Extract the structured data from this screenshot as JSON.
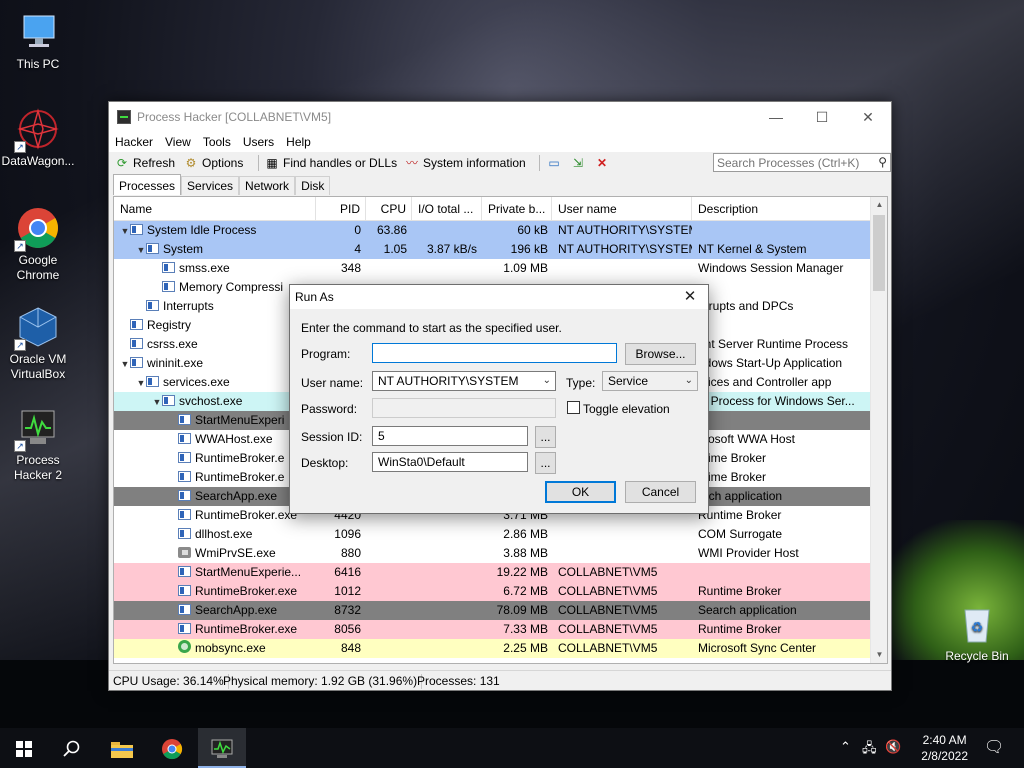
{
  "desktop": {
    "icons": [
      {
        "label": "This PC"
      },
      {
        "label": "DataWagon..."
      },
      {
        "label": "Google Chrome"
      },
      {
        "label": "Oracle VM VirtualBox"
      },
      {
        "label": "Process Hacker 2"
      },
      {
        "label": "Recycle Bin"
      }
    ]
  },
  "window": {
    "title": "Process Hacker [COLLABNET\\VM5]",
    "controls": {
      "minimize": "—",
      "maximize": "☐",
      "close": "✕"
    },
    "menu": [
      "Hacker",
      "View",
      "Tools",
      "Users",
      "Help"
    ],
    "toolbar": {
      "refresh": "Refresh",
      "options": "Options",
      "find_handles": "Find handles or DLLs",
      "system_info": "System information"
    },
    "search": {
      "placeholder": "Search Processes (Ctrl+K)"
    },
    "tabs": [
      "Processes",
      "Services",
      "Network",
      "Disk"
    ],
    "columns": [
      "Name",
      "PID",
      "CPU",
      "I/O total ...",
      "Private b...",
      "User name",
      "Description"
    ],
    "rows": [
      {
        "name": "System Idle Process",
        "pid": "0",
        "cpu": "63.86",
        "io": "",
        "priv": "60 kB",
        "user": "NT AUTHORITY\\SYSTEM",
        "desc": "",
        "indent": 0,
        "toggle": "▼",
        "bg": "#a9c6f5"
      },
      {
        "name": "System",
        "pid": "4",
        "cpu": "1.05",
        "io": "3.87 kB/s",
        "priv": "196 kB",
        "user": "NT AUTHORITY\\SYSTEM",
        "desc": "NT Kernel & System",
        "indent": 1,
        "toggle": "▼",
        "bg": "#a9c6f5"
      },
      {
        "name": "smss.exe",
        "pid": "348",
        "cpu": "",
        "io": "",
        "priv": "1.09 MB",
        "user": "",
        "desc": "Windows Session Manager",
        "indent": 2,
        "toggle": "",
        "bg": "#ffffff"
      },
      {
        "name": "Memory Compressi",
        "pid": "",
        "cpu": "",
        "io": "",
        "priv": "",
        "user": "",
        "desc": "",
        "indent": 2,
        "toggle": "",
        "bg": "#ffffff"
      },
      {
        "name": "Interrupts",
        "pid": "",
        "cpu": "",
        "io": "",
        "priv": "",
        "user": "",
        "desc": "errupts and DPCs",
        "indent": 1,
        "toggle": "",
        "bg": "#ffffff"
      },
      {
        "name": "Registry",
        "pid": "",
        "cpu": "",
        "io": "",
        "priv": "",
        "user": "",
        "desc": "",
        "indent": 0,
        "toggle": "",
        "bg": "#ffffff"
      },
      {
        "name": "csrss.exe",
        "pid": "",
        "cpu": "",
        "io": "",
        "priv": "",
        "user": "",
        "desc": "ent Server Runtime Process",
        "indent": 0,
        "toggle": "",
        "bg": "#ffffff"
      },
      {
        "name": "wininit.exe",
        "pid": "",
        "cpu": "",
        "io": "",
        "priv": "",
        "user": "",
        "desc": "ndows Start-Up Application",
        "indent": 0,
        "toggle": "▼",
        "bg": "#ffffff"
      },
      {
        "name": "services.exe",
        "pid": "",
        "cpu": "",
        "io": "",
        "priv": "",
        "user": "",
        "desc": "rvices and Controller app",
        "indent": 1,
        "toggle": "▼",
        "bg": "#ffffff"
      },
      {
        "name": "svchost.exe",
        "pid": "",
        "cpu": "",
        "io": "",
        "priv": "",
        "user": "",
        "desc": "st Process for Windows Ser...",
        "indent": 2,
        "toggle": "▼",
        "bg": "#cdf5f5"
      },
      {
        "name": "StartMenuExperi",
        "pid": "",
        "cpu": "",
        "io": "",
        "priv": "",
        "user": "",
        "desc": "",
        "indent": 3,
        "toggle": "",
        "bg": "#808080"
      },
      {
        "name": "WWAHost.exe",
        "pid": "",
        "cpu": "",
        "io": "",
        "priv": "",
        "user": "",
        "desc": "crosoft WWA Host",
        "indent": 3,
        "toggle": "",
        "bg": "#ffffff"
      },
      {
        "name": "RuntimeBroker.e",
        "pid": "",
        "cpu": "",
        "io": "",
        "priv": "",
        "user": "",
        "desc": "ntime Broker",
        "indent": 3,
        "toggle": "",
        "bg": "#ffffff"
      },
      {
        "name": "RuntimeBroker.e",
        "pid": "",
        "cpu": "",
        "io": "",
        "priv": "",
        "user": "",
        "desc": "ntime Broker",
        "indent": 3,
        "toggle": "",
        "bg": "#ffffff"
      },
      {
        "name": "SearchApp.exe",
        "pid": "",
        "cpu": "",
        "io": "",
        "priv": "",
        "user": "",
        "desc": "arch application",
        "indent": 3,
        "toggle": "",
        "bg": "#808080"
      },
      {
        "name": "RuntimeBroker.exe",
        "pid": "4420",
        "cpu": "",
        "io": "",
        "priv": "3.71 MB",
        "user": "",
        "desc": "Runtime Broker",
        "indent": 3,
        "toggle": "",
        "bg": "#ffffff"
      },
      {
        "name": "dllhost.exe",
        "pid": "1096",
        "cpu": "",
        "io": "",
        "priv": "2.86 MB",
        "user": "",
        "desc": "COM Surrogate",
        "indent": 3,
        "toggle": "",
        "bg": "#ffffff",
        "icon": "blank"
      },
      {
        "name": "WmiPrvSE.exe",
        "pid": "880",
        "cpu": "",
        "io": "",
        "priv": "3.88 MB",
        "user": "",
        "desc": "WMI Provider Host",
        "indent": 3,
        "toggle": "",
        "bg": "#ffffff",
        "icon": "gear"
      },
      {
        "name": "StartMenuExperie...",
        "pid": "6416",
        "cpu": "",
        "io": "",
        "priv": "19.22 MB",
        "user": "COLLABNET\\VM5",
        "desc": "",
        "indent": 3,
        "toggle": "",
        "bg": "#ffc8d2"
      },
      {
        "name": "RuntimeBroker.exe",
        "pid": "1012",
        "cpu": "",
        "io": "",
        "priv": "6.72 MB",
        "user": "COLLABNET\\VM5",
        "desc": "Runtime Broker",
        "indent": 3,
        "toggle": "",
        "bg": "#ffc8d2"
      },
      {
        "name": "SearchApp.exe",
        "pid": "8732",
        "cpu": "",
        "io": "",
        "priv": "78.09 MB",
        "user": "COLLABNET\\VM5",
        "desc": "Search application",
        "indent": 3,
        "toggle": "",
        "bg": "#808080"
      },
      {
        "name": "RuntimeBroker.exe",
        "pid": "8056",
        "cpu": "",
        "io": "",
        "priv": "7.33 MB",
        "user": "COLLABNET\\VM5",
        "desc": "Runtime Broker",
        "indent": 3,
        "toggle": "",
        "bg": "#ffc8d2"
      },
      {
        "name": "mobsync.exe",
        "pid": "848",
        "cpu": "",
        "io": "",
        "priv": "2.25 MB",
        "user": "COLLABNET\\VM5",
        "desc": "Microsoft Sync Center",
        "indent": 3,
        "toggle": "",
        "bg": "#ffffc0",
        "icon": "sync"
      }
    ],
    "status": {
      "cpu": "CPU Usage: 36.14%",
      "memory": "Physical memory: 1.92 GB (31.96%)",
      "processes": "Processes: 131"
    }
  },
  "dialog": {
    "title": "Run As",
    "close": "✕",
    "instruction": "Enter the command to start as the specified user.",
    "program_label": "Program:",
    "program_value": "",
    "browse": "Browse...",
    "username_label": "User name:",
    "username_value": "NT AUTHORITY\\SYSTEM",
    "type_label": "Type:",
    "type_value": "Service",
    "password_label": "Password:",
    "password_value": "",
    "toggle_elevation": "Toggle elevation",
    "session_label": "Session ID:",
    "session_value": "5",
    "desktop_label": "Desktop:",
    "desktop_value": "WinSta0\\Default",
    "ellipsis": "...",
    "ok": "OK",
    "cancel": "Cancel"
  },
  "taskbar": {
    "time": "2:40 AM",
    "date": "2/8/2022"
  }
}
